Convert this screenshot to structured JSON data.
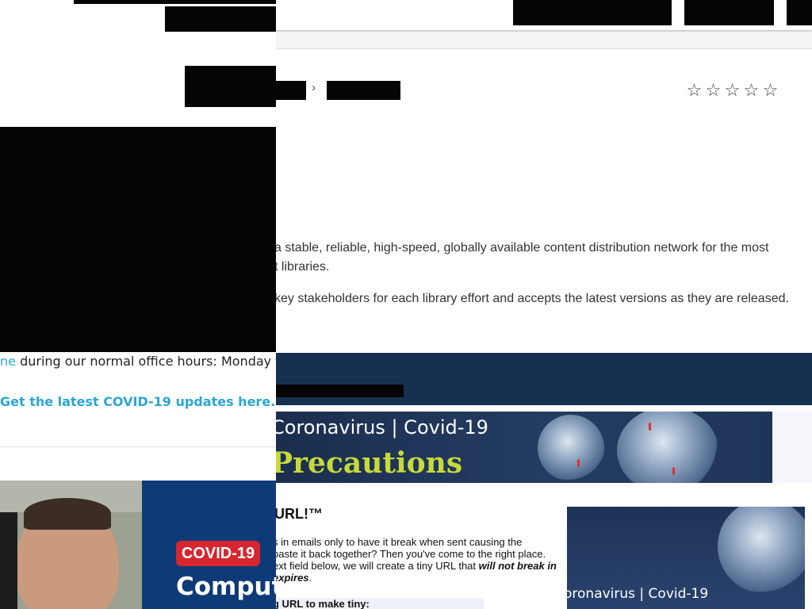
{
  "rating": {
    "stars": [
      "☆",
      "☆",
      "☆",
      "☆",
      "☆"
    ],
    "value": 0,
    "max": 5
  },
  "breadcrumb": {
    "separator": "›"
  },
  "description": {
    "line1": "a stable, reliable, high-speed, globally available content distribution network for the most",
    "line2": "t libraries.",
    "line3": "key stakeholders for each library effort and accepts the latest versions as they are released."
  },
  "left": {
    "office_link": "ne",
    "office_text": " during our normal office hours: Monday th",
    "covid_link": "Get the latest COVID-19 updates here.",
    "card_badge": "COVID-19",
    "card_title": "Compute"
  },
  "banner": {
    "top": "Coronavirus  |  Covid-19",
    "big": "Precautions"
  },
  "tinyurl": {
    "heading": "URL!™",
    "p_line1": "s in emails only to have it break when sent causing the",
    "p_line2": "paste it back together? Then you've come to the right place.",
    "p_line3_plain": "ext field below, we will create a tiny URL that ",
    "p_line3_em": "will not break in",
    "p_line4_em": "expires",
    "p_line4_end": ".",
    "field_label": "g URL to make tiny:"
  },
  "side_ad": {
    "top": "oronavirus  |  Covid-19"
  },
  "colors": {
    "link": "#2aa6d6",
    "band": "#16304f",
    "banner_accent": "#c7d93a",
    "card_blue": "#0f3a78",
    "badge_red": "#d6262f"
  }
}
